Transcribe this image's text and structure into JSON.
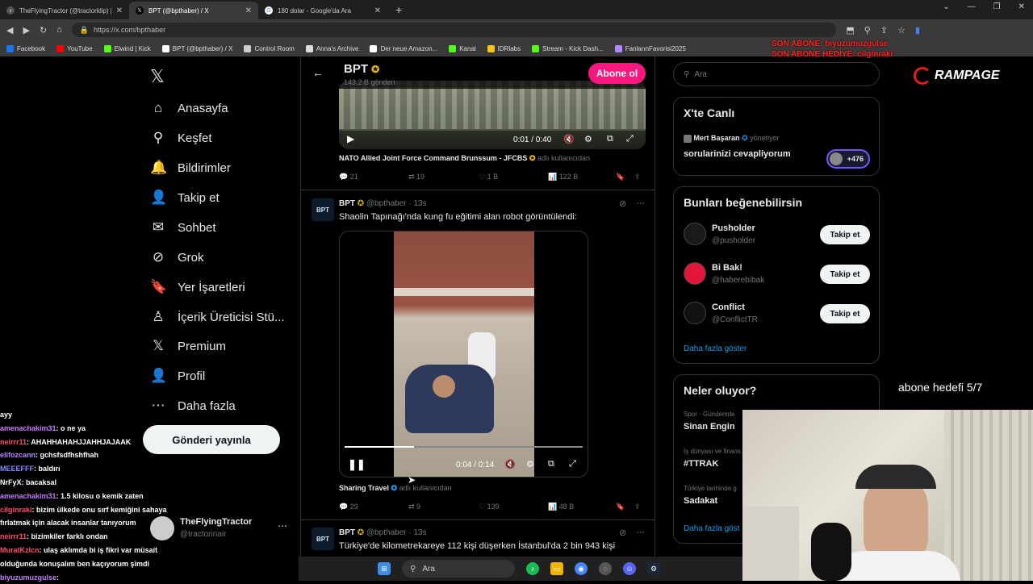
{
  "browser": {
    "tabs": [
      {
        "title": "TheFlyingTractor (@tractorklip) |",
        "icon": "tiktok-icon"
      },
      {
        "title": "BPT (@bpthaber) / X",
        "icon": "x-icon"
      },
      {
        "title": "180 dolar - Google'da Ara",
        "icon": "google-icon"
      }
    ],
    "url": "https://x.com/bpthaber",
    "bookmarks": [
      {
        "label": "Facebook",
        "color": "#1877f2"
      },
      {
        "label": "YouTube",
        "color": "#ff0000"
      },
      {
        "label": "Elwind | Kick",
        "color": "#53fc18"
      },
      {
        "label": "BPT (@bpthaber) / X",
        "color": "#ffffff"
      },
      {
        "label": "Control Room",
        "color": "#cccccc"
      },
      {
        "label": "Anna's Archive",
        "color": "#dddddd"
      },
      {
        "label": "Der neue Amazon...",
        "color": "#ffffff"
      },
      {
        "label": "Kanal",
        "color": "#53fc18"
      },
      {
        "label": "IDRlabs",
        "color": "#f5c518"
      },
      {
        "label": "Stream - Kick Dash...",
        "color": "#53fc18"
      },
      {
        "label": "FanlarınFavorisi2025",
        "color": "#b388ff"
      }
    ]
  },
  "stream_overlay": {
    "top_alert_line1": "SON ABONE: biyuzumuzgulse",
    "top_alert_line2": "SON ABONE HEDİYE: cilginraki",
    "brand": "RAMPAGE",
    "goal": "abone hedefi 5/7"
  },
  "nav": {
    "items": [
      {
        "label": "Anasayfa",
        "icon": "home-icon",
        "glyph": "⌂"
      },
      {
        "label": "Keşfet",
        "icon": "search-icon",
        "glyph": "⚲"
      },
      {
        "label": "Bildirimler",
        "icon": "bell-icon",
        "glyph": "🔔"
      },
      {
        "label": "Takip et",
        "icon": "add-user-icon",
        "glyph": "👤"
      },
      {
        "label": "Sohbet",
        "icon": "mail-icon",
        "glyph": "✉"
      },
      {
        "label": "Grok",
        "icon": "grok-icon",
        "glyph": "⊘"
      },
      {
        "label": "Yer İşaretleri",
        "icon": "bookmark-icon",
        "glyph": "🔖"
      },
      {
        "label": "İçerik Üreticisi Stü...",
        "icon": "creator-studio-icon",
        "glyph": "♙"
      },
      {
        "label": "Premium",
        "icon": "x-premium-icon",
        "glyph": "𝕏"
      },
      {
        "label": "Profil",
        "icon": "profile-icon",
        "glyph": "👤"
      },
      {
        "label": "Daha fazla",
        "icon": "more-icon",
        "glyph": "⋯"
      }
    ],
    "post_button": "Gönderi yayınla",
    "account": {
      "name": "TheFlyingTractor",
      "handle": "@tractorinair"
    }
  },
  "profile_header": {
    "name": "BPT",
    "posts": "143,2 B gönderi",
    "follow_button": "Abone ol"
  },
  "tweets": [
    {
      "video_time": "0:01 / 0:40",
      "source": "NATO Allied Joint Force Command Brunssum - JFCBS",
      "source_suffix": "adlı kullanıcıdan",
      "replies": "21",
      "retweets": "19",
      "likes": "1 B",
      "views": "122 B"
    },
    {
      "name": "BPT",
      "handle": "@bpthaber",
      "time": "13s",
      "text": "Shaolin Tapınağı'nda kung fu eğitimi alan robot görüntülendi:",
      "video_time": "0:04 / 0:14",
      "video_progress": 0.29,
      "source": "Sharing Travel",
      "source_suffix": "adlı kullanıcıdan",
      "replies": "29",
      "retweets": "9",
      "likes": "139",
      "views": "48 B"
    },
    {
      "name": "BPT",
      "handle": "@bpthaber",
      "time": "13s",
      "text": "Türkiye'de kilometrekareye 112 kişi düşerken İstanbul'da 2 bin 943 kişi"
    }
  ],
  "sidebar": {
    "search_placeholder": "Ara",
    "live": {
      "title": "X'te Canlı",
      "host": "Mert Başaran",
      "role": "yönetiyor",
      "topic": "sorularinizi cevapliyorum",
      "listeners": "+476"
    },
    "suggest": {
      "title": "Bunları beğenebilirsin",
      "follow_label": "Takip et",
      "accounts": [
        {
          "name": "Pusholder",
          "handle": "@pusholder"
        },
        {
          "name": "Bi Bak!",
          "handle": "@haberebibak"
        },
        {
          "name": "Conflict",
          "handle": "@ConflictTR"
        }
      ],
      "more": "Daha fazla göster"
    },
    "trends": {
      "title": "Neler oluyor?",
      "items": [
        {
          "context": "Spor · Gündemde",
          "name": "Sinan Engin"
        },
        {
          "context": "İş dünyası ve finans",
          "name": "#TTRAK"
        },
        {
          "context": "Türkiye tarihinde g",
          "name": "Sadakat"
        }
      ],
      "more": "Daha fazla göst"
    }
  },
  "chat": [
    {
      "user": "",
      "msg": "ayy",
      "color": "#8a8aff"
    },
    {
      "user": "amenachakim31",
      "msg": ": o ne ya",
      "color": "#c77dff"
    },
    {
      "user": "neirrr11",
      "msg": ": AHAHHAHAHJJAHHJAJAAK",
      "color": "#ff4d6d"
    },
    {
      "user": "elifozcann",
      "msg": ": gchsfsdfhshfhah",
      "color": "#b388ff"
    },
    {
      "user": "MEEEFFF",
      "msg": ": baldırı",
      "color": "#8a8aff"
    },
    {
      "user": "NrFyX",
      "msg": ": bacaksal",
      "color": "#ffffff"
    },
    {
      "user": "amenachakim31",
      "msg": ": 1.5 kilosu o kemik zaten",
      "color": "#c77dff"
    },
    {
      "user": "cilginraki",
      "msg": ": bizim ülkede onu sırf kemiğini sahaya",
      "color": "#ff4d6d"
    },
    {
      "user": "",
      "msg": "fırlatmak için alacak insanlar tanıyorum",
      "color": "#ffffff"
    },
    {
      "user": "neirrr11",
      "msg": ": bizimkiler farklı ondan",
      "color": "#ff4d6d"
    },
    {
      "user": "MuratKzlcn",
      "msg": ": ulaş aklımda bi iş fikri var müsait",
      "color": "#ff4d6d"
    },
    {
      "user": "",
      "msg": "olduğunda konuşalım ben kaçıyorum şimdi",
      "color": "#ffffff"
    },
    {
      "user": "biyuzumuzgulse",
      "msg": ":",
      "color": "#c77dff"
    }
  ],
  "taskbar": {
    "search": "Ara"
  }
}
